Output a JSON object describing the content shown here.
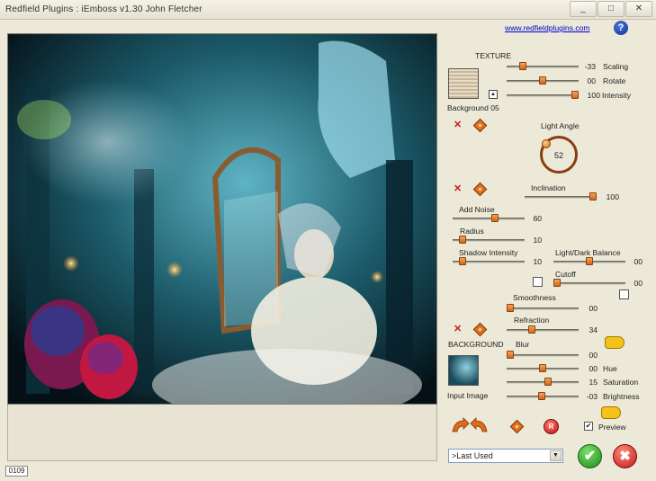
{
  "window": {
    "title": "Redfield  Plugins  :  iEmboss  v1.30    John Fletcher",
    "minimize_glyph": "_",
    "maximize_glyph": "□",
    "close_glyph": "✕"
  },
  "header": {
    "link": "www.redfieldplugins.com",
    "help_glyph": "?"
  },
  "frame_counter": "0109",
  "texture": {
    "section_label": "TEXTURE",
    "name": "Background 05",
    "up_glyph": "▲",
    "remove_glyph": "✕",
    "scaling": {
      "label": "Scaling",
      "value": "-33",
      "fraction": 0.2
    },
    "rotate": {
      "label": "Rotate",
      "value": "00",
      "fraction": 0.5
    },
    "intensity": {
      "label": "Intensity",
      "value": "100",
      "fraction": 1.0
    }
  },
  "light": {
    "label": "Light  Angle",
    "angle": "52",
    "remove_glyph": "✕",
    "inclination": {
      "label": "Inclination",
      "value": "100",
      "fraction": 1.0
    }
  },
  "noise": {
    "add_noise": {
      "label": "Add Noise",
      "value": "60",
      "fraction": 0.6
    },
    "radius": {
      "label": "Radius",
      "value": "10",
      "fraction": 0.1
    },
    "shadow_intensity": {
      "label": "Shadow Intensity",
      "value": "10",
      "fraction": 0.1
    },
    "light_dark_balance": {
      "label": "Light/Dark Balance",
      "value": "00",
      "fraction": 0.5
    },
    "cutoff": {
      "label": "Cutoff",
      "value": "00",
      "fraction": 0.0
    },
    "smoothness": {
      "label": "Smoothness",
      "value": "00",
      "fraction": 0.0
    },
    "refraction": {
      "label": "Refraction",
      "value": "34",
      "fraction": 0.34
    },
    "remove_glyph": "✕"
  },
  "background": {
    "section_label": "BACKGROUND",
    "name": "Input Image",
    "blur": {
      "label": "Blur",
      "value": "00",
      "fraction": 0.0
    },
    "hue": {
      "label": "Hue",
      "value": "00",
      "fraction": 0.5
    },
    "saturation": {
      "label": "Saturation",
      "value": "15",
      "fraction": 0.58
    },
    "brightness": {
      "label": "Brightness",
      "value": "-03",
      "fraction": 0.48
    }
  },
  "footer": {
    "reset_glyph": "R",
    "preview_label": "Preview",
    "preview_checked": true,
    "preset_value": ">Last Used",
    "ok_glyph": "✔",
    "cancel_glyph": "✖"
  }
}
